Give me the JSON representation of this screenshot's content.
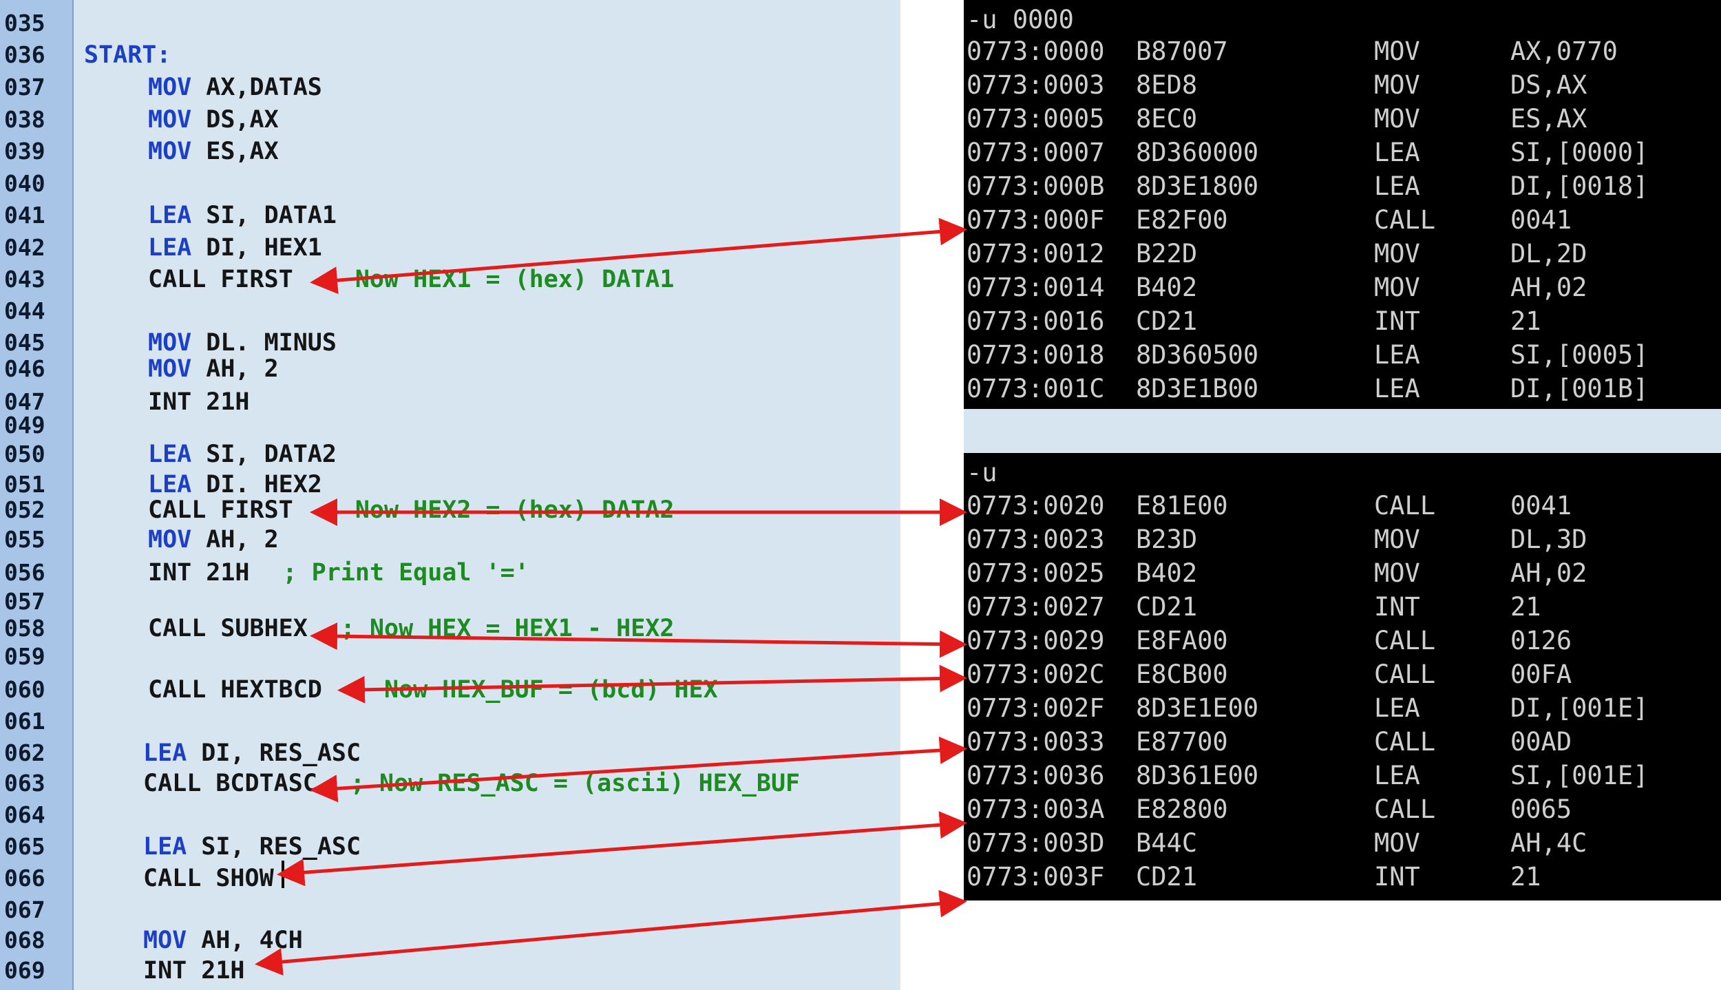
{
  "editor": {
    "line_numbers": [
      "035",
      "036",
      "037",
      "038",
      "039",
      "040",
      "041",
      "042",
      "043",
      "044",
      "045",
      "046",
      "047",
      "049",
      "050",
      "051",
      "052",
      "055",
      "056",
      "057",
      "058",
      "059",
      "060",
      "061",
      "062",
      "063",
      "064",
      "065",
      "066",
      "067",
      "068",
      "069"
    ],
    "lines": [
      {
        "label": ""
      },
      {
        "label": "START:"
      },
      {
        "kw": "MOV",
        "op": " AX,DATAS"
      },
      {
        "kw": "MOV",
        "op": " DS,AX"
      },
      {
        "kw": "MOV",
        "op": " ES,AX"
      },
      {},
      {
        "kw": "LEA",
        "op": " SI, DATA1"
      },
      {
        "kw": "LEA",
        "op": " DI, HEX1"
      },
      {
        "plain": "CALL FIRST",
        "comment": "; Now HEX1 = (hex) DATA1"
      },
      {},
      {
        "kw": "MOV",
        "op": " DL. MINUS"
      },
      {
        "kw": "MOV",
        "op": " AH, 2"
      },
      {
        "plain": "INT 21H"
      },
      {},
      {
        "kw": "LEA",
        "op": " SI, DATA2"
      },
      {
        "kw": "LEA",
        "op": " DI. HEX2"
      },
      {
        "plain": "CALL FIRST",
        "comment": "; Now HEX2 = (hex) DATA2"
      },
      {
        "kw": "MOV",
        "op": " AH, 2"
      },
      {
        "plain": "INT 21H",
        "comment": "; Print Equal '='"
      },
      {},
      {
        "plain": "CALL SUBHEX",
        "comment": "; Now HEX = HEX1 - HEX2"
      },
      {},
      {
        "plain": "CALL HEXTBCD",
        "comment": "; Now HEX_BUF = (bcd) HEX"
      },
      {},
      {
        "kw": "LEA",
        "op": " DI, RES_ASC"
      },
      {
        "plain": "CALL BCDTASC",
        "comment": "; Now RES_ASC = (ascii) HEX_BUF"
      },
      {},
      {
        "kw": "LEA",
        "op": " SI, RES_ASC"
      },
      {
        "plain": "CALL SHOW"
      },
      {},
      {
        "kw": "MOV",
        "op": " AH, 4CH"
      },
      {
        "plain": "INT 21H"
      }
    ]
  },
  "terminal1": {
    "command": "-u 0000",
    "rows": [
      {
        "addr": "0773:0000",
        "bytes": "B87007",
        "mn": "MOV",
        "op": "AX,0770"
      },
      {
        "addr": "0773:0003",
        "bytes": "8ED8",
        "mn": "MOV",
        "op": "DS,AX"
      },
      {
        "addr": "0773:0005",
        "bytes": "8EC0",
        "mn": "MOV",
        "op": "ES,AX"
      },
      {
        "addr": "0773:0007",
        "bytes": "8D360000",
        "mn": "LEA",
        "op": "SI,[0000]"
      },
      {
        "addr": "0773:000B",
        "bytes": "8D3E1800",
        "mn": "LEA",
        "op": "DI,[0018]"
      },
      {
        "addr": "0773:000F",
        "bytes": "E82F00",
        "mn": "CALL",
        "op": "0041"
      },
      {
        "addr": "0773:0012",
        "bytes": "B22D",
        "mn": "MOV",
        "op": "DL,2D"
      },
      {
        "addr": "0773:0014",
        "bytes": "B402",
        "mn": "MOV",
        "op": "AH,02"
      },
      {
        "addr": "0773:0016",
        "bytes": "CD21",
        "mn": "INT",
        "op": "21"
      },
      {
        "addr": "0773:0018",
        "bytes": "8D360500",
        "mn": "LEA",
        "op": "SI,[0005]"
      },
      {
        "addr": "0773:001C",
        "bytes": "8D3E1B00",
        "mn": "LEA",
        "op": "DI,[001B]"
      }
    ]
  },
  "terminal2": {
    "command": "-u",
    "rows": [
      {
        "addr": "0773:0020",
        "bytes": "E81E00",
        "mn": "CALL",
        "op": "0041"
      },
      {
        "addr": "0773:0023",
        "bytes": "B23D",
        "mn": "MOV",
        "op": "DL,3D"
      },
      {
        "addr": "0773:0025",
        "bytes": "B402",
        "mn": "MOV",
        "op": "AH,02"
      },
      {
        "addr": "0773:0027",
        "bytes": "CD21",
        "mn": "INT",
        "op": "21"
      },
      {
        "addr": "0773:0029",
        "bytes": "E8FA00",
        "mn": "CALL",
        "op": "0126"
      },
      {
        "addr": "0773:002C",
        "bytes": "E8CB00",
        "mn": "CALL",
        "op": "00FA"
      },
      {
        "addr": "0773:002F",
        "bytes": "8D3E1E00",
        "mn": "LEA",
        "op": "DI,[001E]"
      },
      {
        "addr": "0773:0033",
        "bytes": "E87700",
        "mn": "CALL",
        "op": "00AD"
      },
      {
        "addr": "0773:0036",
        "bytes": "8D361E00",
        "mn": "LEA",
        "op": "SI,[001E]"
      },
      {
        "addr": "0773:003A",
        "bytes": "E82800",
        "mn": "CALL",
        "op": "0065"
      },
      {
        "addr": "0773:003D",
        "bytes": "B44C",
        "mn": "MOV",
        "op": "AH,4C"
      },
      {
        "addr": "0773:003F",
        "bytes": "CD21",
        "mn": "INT",
        "op": "21"
      }
    ]
  },
  "colors": {
    "editor_bg": "#d6e5ef",
    "gutter_bg": "#a8c4e6",
    "keyword": "#1d3fc4",
    "comment": "#1d8a22",
    "terminal_bg": "#000000",
    "terminal_fg": "#cfcfcf",
    "arrow": "#e41b1b"
  }
}
